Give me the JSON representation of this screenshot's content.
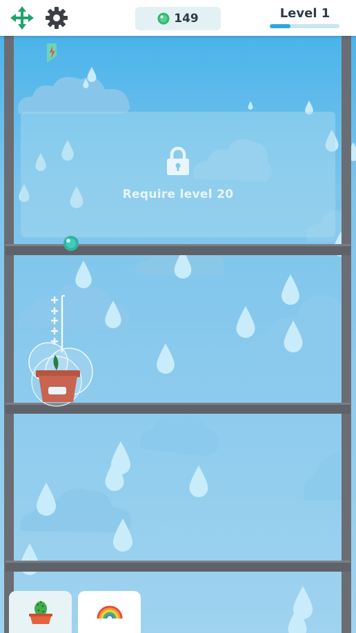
{
  "topbar": {
    "move_icon": "move-arrows-icon",
    "settings_icon": "gear-icon",
    "coins": "149",
    "level_label": "Level 1",
    "level_progress": 0.3
  },
  "locked_shelf": {
    "message": "Require level 20",
    "icon": "padlock-icon"
  },
  "plant": {
    "pot_label": ""
  },
  "tabs": [
    {
      "name": "plants",
      "icon": "cactus-pot-icon"
    },
    {
      "name": "weather",
      "icon": "rainbow-icon"
    }
  ],
  "colors": {
    "accent_green": "#1fa36b",
    "level_fill": "#2ea7df",
    "pot": "#c8644f",
    "shelf": "#5f6268"
  }
}
